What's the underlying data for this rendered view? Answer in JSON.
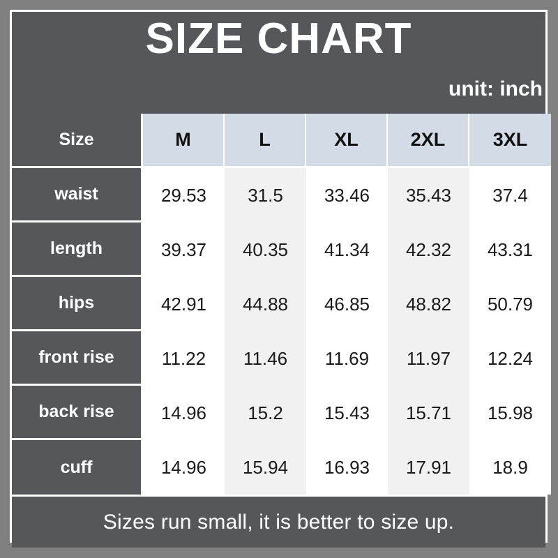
{
  "header": {
    "title": "SIZE CHART",
    "unit_label": "unit: inch"
  },
  "footer": {
    "note": "Sizes run small, it is better to size up."
  },
  "colors": {
    "frame_gray": "#808080",
    "panel_dark": "#55575a",
    "header_cell": "#d3dbe6",
    "cell_white": "#ffffff",
    "cell_shade": "#f1f1f1",
    "border_white": "#ffffff",
    "text_light": "#ffffff",
    "text_dark": "#1a1a1a"
  },
  "chart_data": {
    "type": "table",
    "title": "SIZE CHART",
    "unit": "inch",
    "corner_header": "Size",
    "columns": [
      "M",
      "L",
      "XL",
      "2XL",
      "3XL"
    ],
    "rows": [
      {
        "label": "waist",
        "values": [
          "29.53",
          "31.5",
          "33.46",
          "35.43",
          "37.4"
        ]
      },
      {
        "label": "length",
        "values": [
          "39.37",
          "40.35",
          "41.34",
          "42.32",
          "43.31"
        ]
      },
      {
        "label": "hips",
        "values": [
          "42.91",
          "44.88",
          "46.85",
          "48.82",
          "50.79"
        ]
      },
      {
        "label": "front rise",
        "values": [
          "11.22",
          "11.46",
          "11.69",
          "11.97",
          "12.24"
        ]
      },
      {
        "label": "back rise",
        "values": [
          "14.96",
          "15.2",
          "15.43",
          "15.71",
          "15.98"
        ]
      },
      {
        "label": "cuff",
        "values": [
          "14.96",
          "15.94",
          "16.93",
          "17.91",
          "18.9"
        ]
      }
    ],
    "note": "Sizes run small, it is better to size up."
  }
}
